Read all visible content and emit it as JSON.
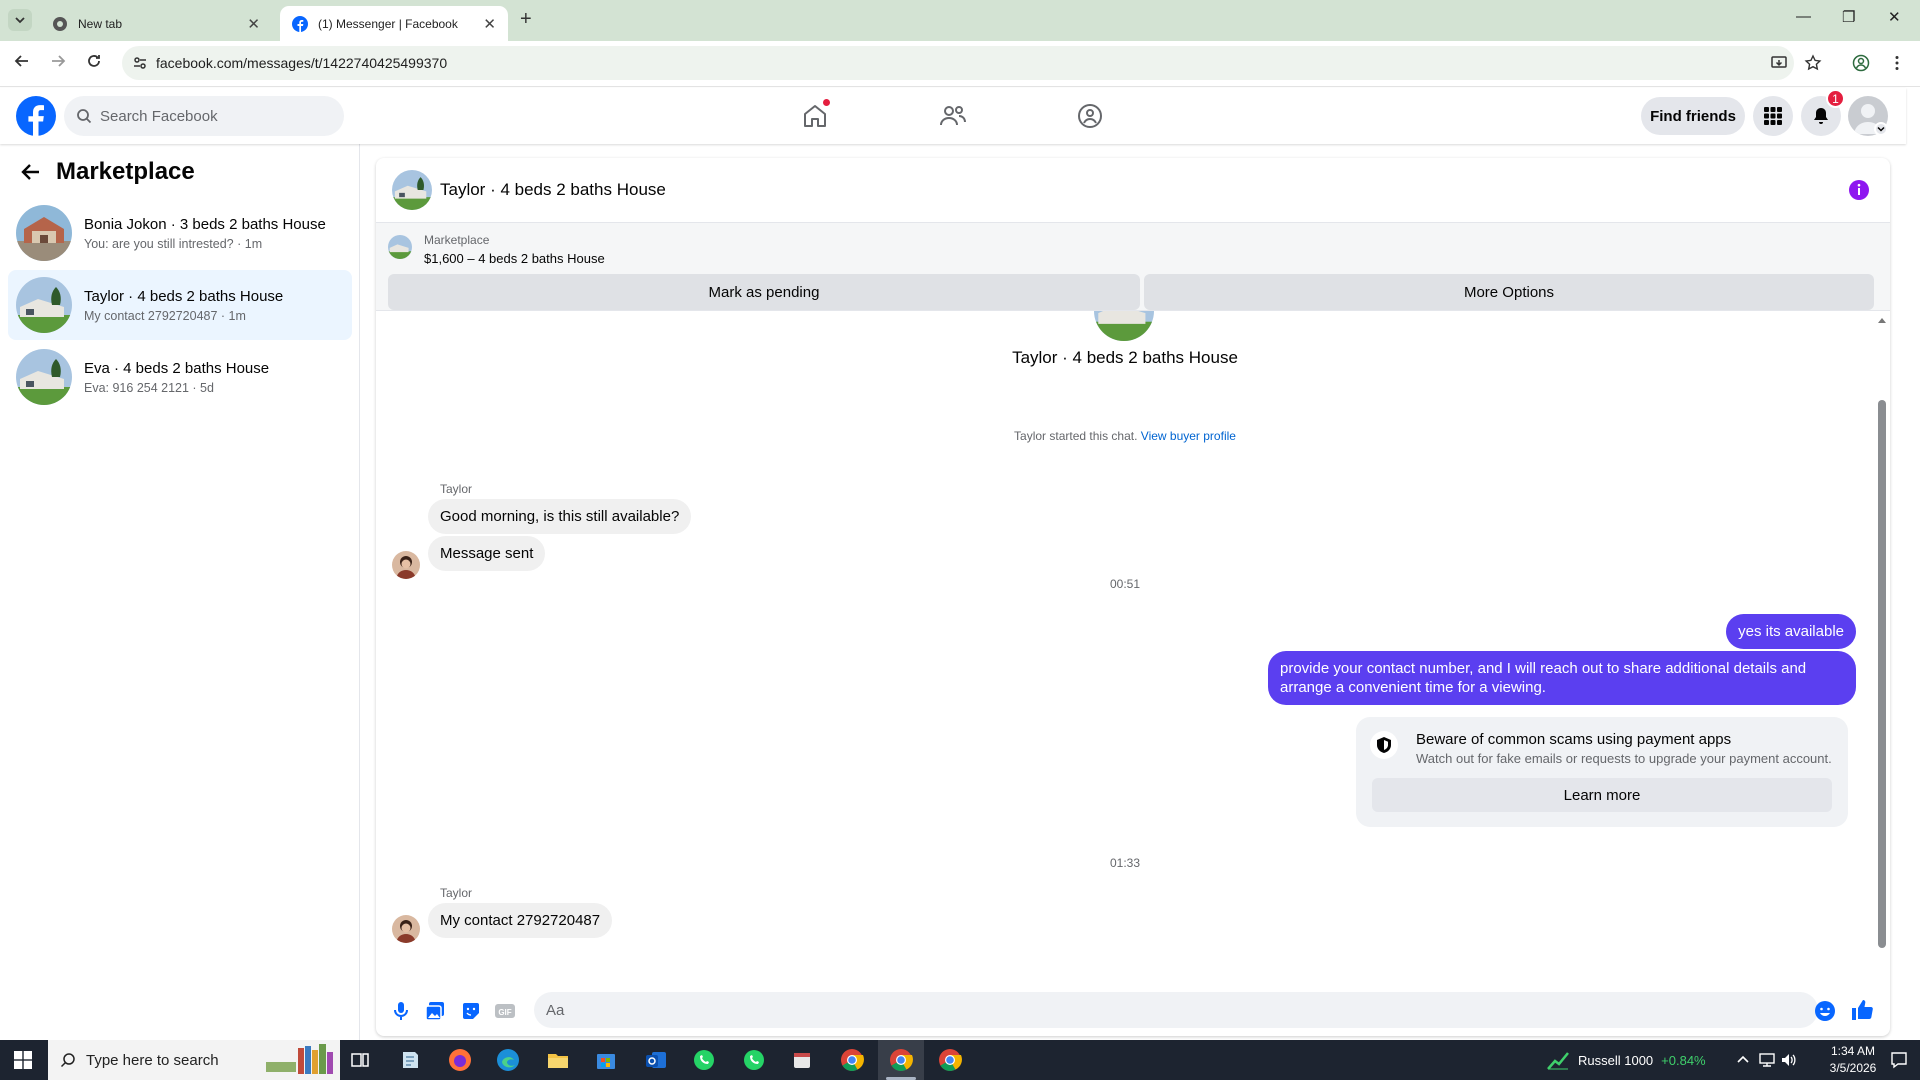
{
  "browser": {
    "tabs": [
      {
        "title": "New tab"
      },
      {
        "title": "(1) Messenger | Facebook"
      }
    ],
    "url": "facebook.com/messages/t/1422740425499370"
  },
  "fb_header": {
    "search_placeholder": "Search Facebook",
    "find_friends": "Find friends",
    "notification_count": "1"
  },
  "sidebar": {
    "title": "Marketplace",
    "conversations": [
      {
        "name": "Bonia Jokon · 3 beds 2 baths House",
        "preview": "You: are you still intrested? · 1m"
      },
      {
        "name": "Taylor · 4 beds 2 baths House",
        "preview": "My contact 2792720487 · 1m"
      },
      {
        "name": "Eva · 4 beds 2 baths House",
        "preview": "Eva: 916 254 2121 · 5d"
      }
    ]
  },
  "chat": {
    "title": "Taylor · 4 beds 2 baths House",
    "marketplace_label": "Marketplace",
    "listing": "$1,600 – 4 beds 2 baths House",
    "mark_pending": "Mark as pending",
    "more_options": "More Options",
    "center_title": "Taylor · 4 beds 2 baths House",
    "started_text": "Taylor started this chat.",
    "view_profile": "View buyer profile",
    "sender_name": "Taylor",
    "msg1": "Good morning, is this still available?",
    "msg2": "Message sent",
    "time1": "00:51",
    "out1": "yes its available",
    "out2": "provide your contact number, and I will reach out to share additional details and arrange a convenient time for a viewing.",
    "scam_title": "Beware of common scams using payment apps",
    "scam_sub": "Watch out for fake emails or requests to upgrade your payment account.",
    "learn_more": "Learn more",
    "time2": "01:33",
    "sender_name2": "Taylor",
    "msg3": "My contact 2792720487",
    "composer_placeholder": "Aa"
  },
  "taskbar": {
    "search_placeholder": "Type here to search",
    "stock_name": "Russell 1000",
    "stock_change": "+0.84%",
    "time": "1:34 AM",
    "date": "3/5/2026"
  },
  "colors": {
    "fb_blue": "#0866ff",
    "outgoing_bubble": "#5b3ff0",
    "badge_red": "#e41e3f",
    "stock_green": "#3fd06b"
  }
}
